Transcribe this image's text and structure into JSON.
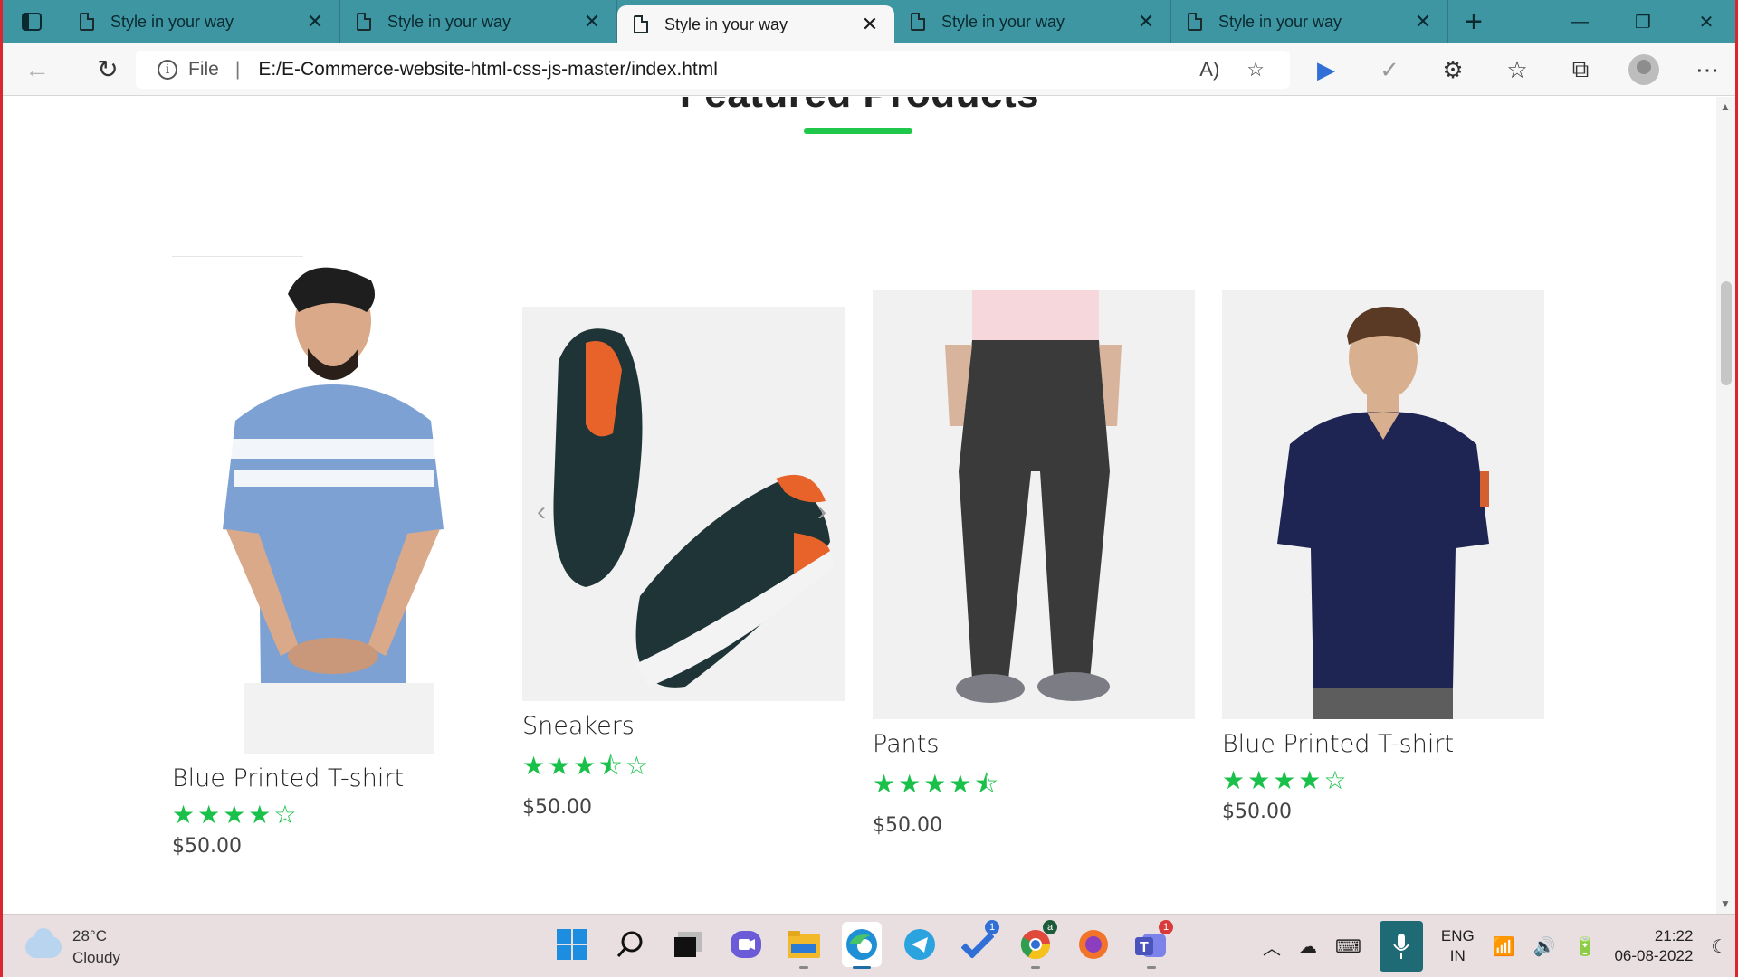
{
  "browser": {
    "tabs": [
      {
        "title": "Style in your way",
        "active": false
      },
      {
        "title": "Style in your way",
        "active": false
      },
      {
        "title": "Style in your way",
        "active": true
      },
      {
        "title": "Style in your way",
        "active": false
      },
      {
        "title": "Style in your way",
        "active": false
      }
    ],
    "address": {
      "scheme_label": "File",
      "url": "E:/E-Commerce-website-html-css-js-master/index.html"
    }
  },
  "page": {
    "section_title": "Featured Products",
    "accent_color": "#1fc74a",
    "products": [
      {
        "name": "Blue Printed T-shirt",
        "rating": 4,
        "stars": "★★★★☆",
        "price": "$50.00"
      },
      {
        "name": "Sneakers",
        "rating": 3.5,
        "stars": "★★★⯪☆",
        "price": "$50.00"
      },
      {
        "name": "Pants",
        "rating": 4.5,
        "stars": "★★★★⯪",
        "price": "$50.00"
      },
      {
        "name": "Blue Printed T-shirt",
        "rating": 4,
        "stars": "★★★★☆",
        "price": "$50.00"
      }
    ]
  },
  "taskbar": {
    "weather_temp": "28°C",
    "weather_desc": "Cloudy",
    "apps": [
      "start-icon",
      "search-icon",
      "task-view-icon",
      "teams-chat-icon",
      "file-explorer-icon",
      "edge-icon",
      "telegram-icon",
      "todo-icon",
      "chrome-icon",
      "firefox-icon",
      "teams-icon"
    ],
    "todo_badge": "1",
    "teams_badge": "1",
    "chrome_badge": "a",
    "language_line1": "ENG",
    "language_line2": "IN",
    "time": "21:22",
    "date": "06-08-2022"
  }
}
